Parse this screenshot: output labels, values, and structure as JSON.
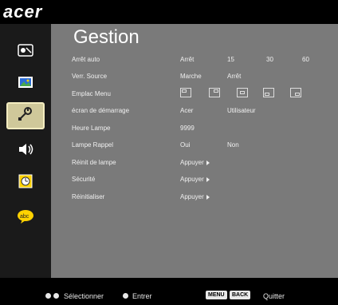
{
  "brand": "acer",
  "title": "Gestion",
  "rows": [
    {
      "label": "Arrêt auto",
      "values": [
        "Arrêt",
        "15",
        "30",
        "60"
      ]
    },
    {
      "label": "Verr. Source",
      "values": [
        "Marche",
        "Arrêt"
      ]
    },
    {
      "label": "Emplac Menu"
    },
    {
      "label": "écran de démarrage",
      "values": [
        "Acer",
        "Utilisateur"
      ]
    },
    {
      "label": "Heure Lampe",
      "values": [
        "9999"
      ]
    },
    {
      "label": "Lampe Rappel",
      "values": [
        "Oui",
        "Non"
      ]
    },
    {
      "label": "Réinit de lampe",
      "button": "Appuyer"
    },
    {
      "label": "Sécurité",
      "button": "Appuyer"
    },
    {
      "label": "Réinitialiser",
      "button": "Appuyer"
    }
  ],
  "sidebar": {
    "icons": [
      "image-settings-icon",
      "picture-icon",
      "management-icon",
      "audio-icon",
      "timer-icon",
      "language-icon"
    ],
    "active": 2
  },
  "footer": {
    "select": "Sélectionner",
    "enter": "Entrer",
    "menu_key": "MENU",
    "back_key": "BACK",
    "quit": "Quitter"
  },
  "colors": {
    "panel": "#7a7a7a",
    "sidebar": "#1a1a1a",
    "active": "#cfc89a"
  }
}
